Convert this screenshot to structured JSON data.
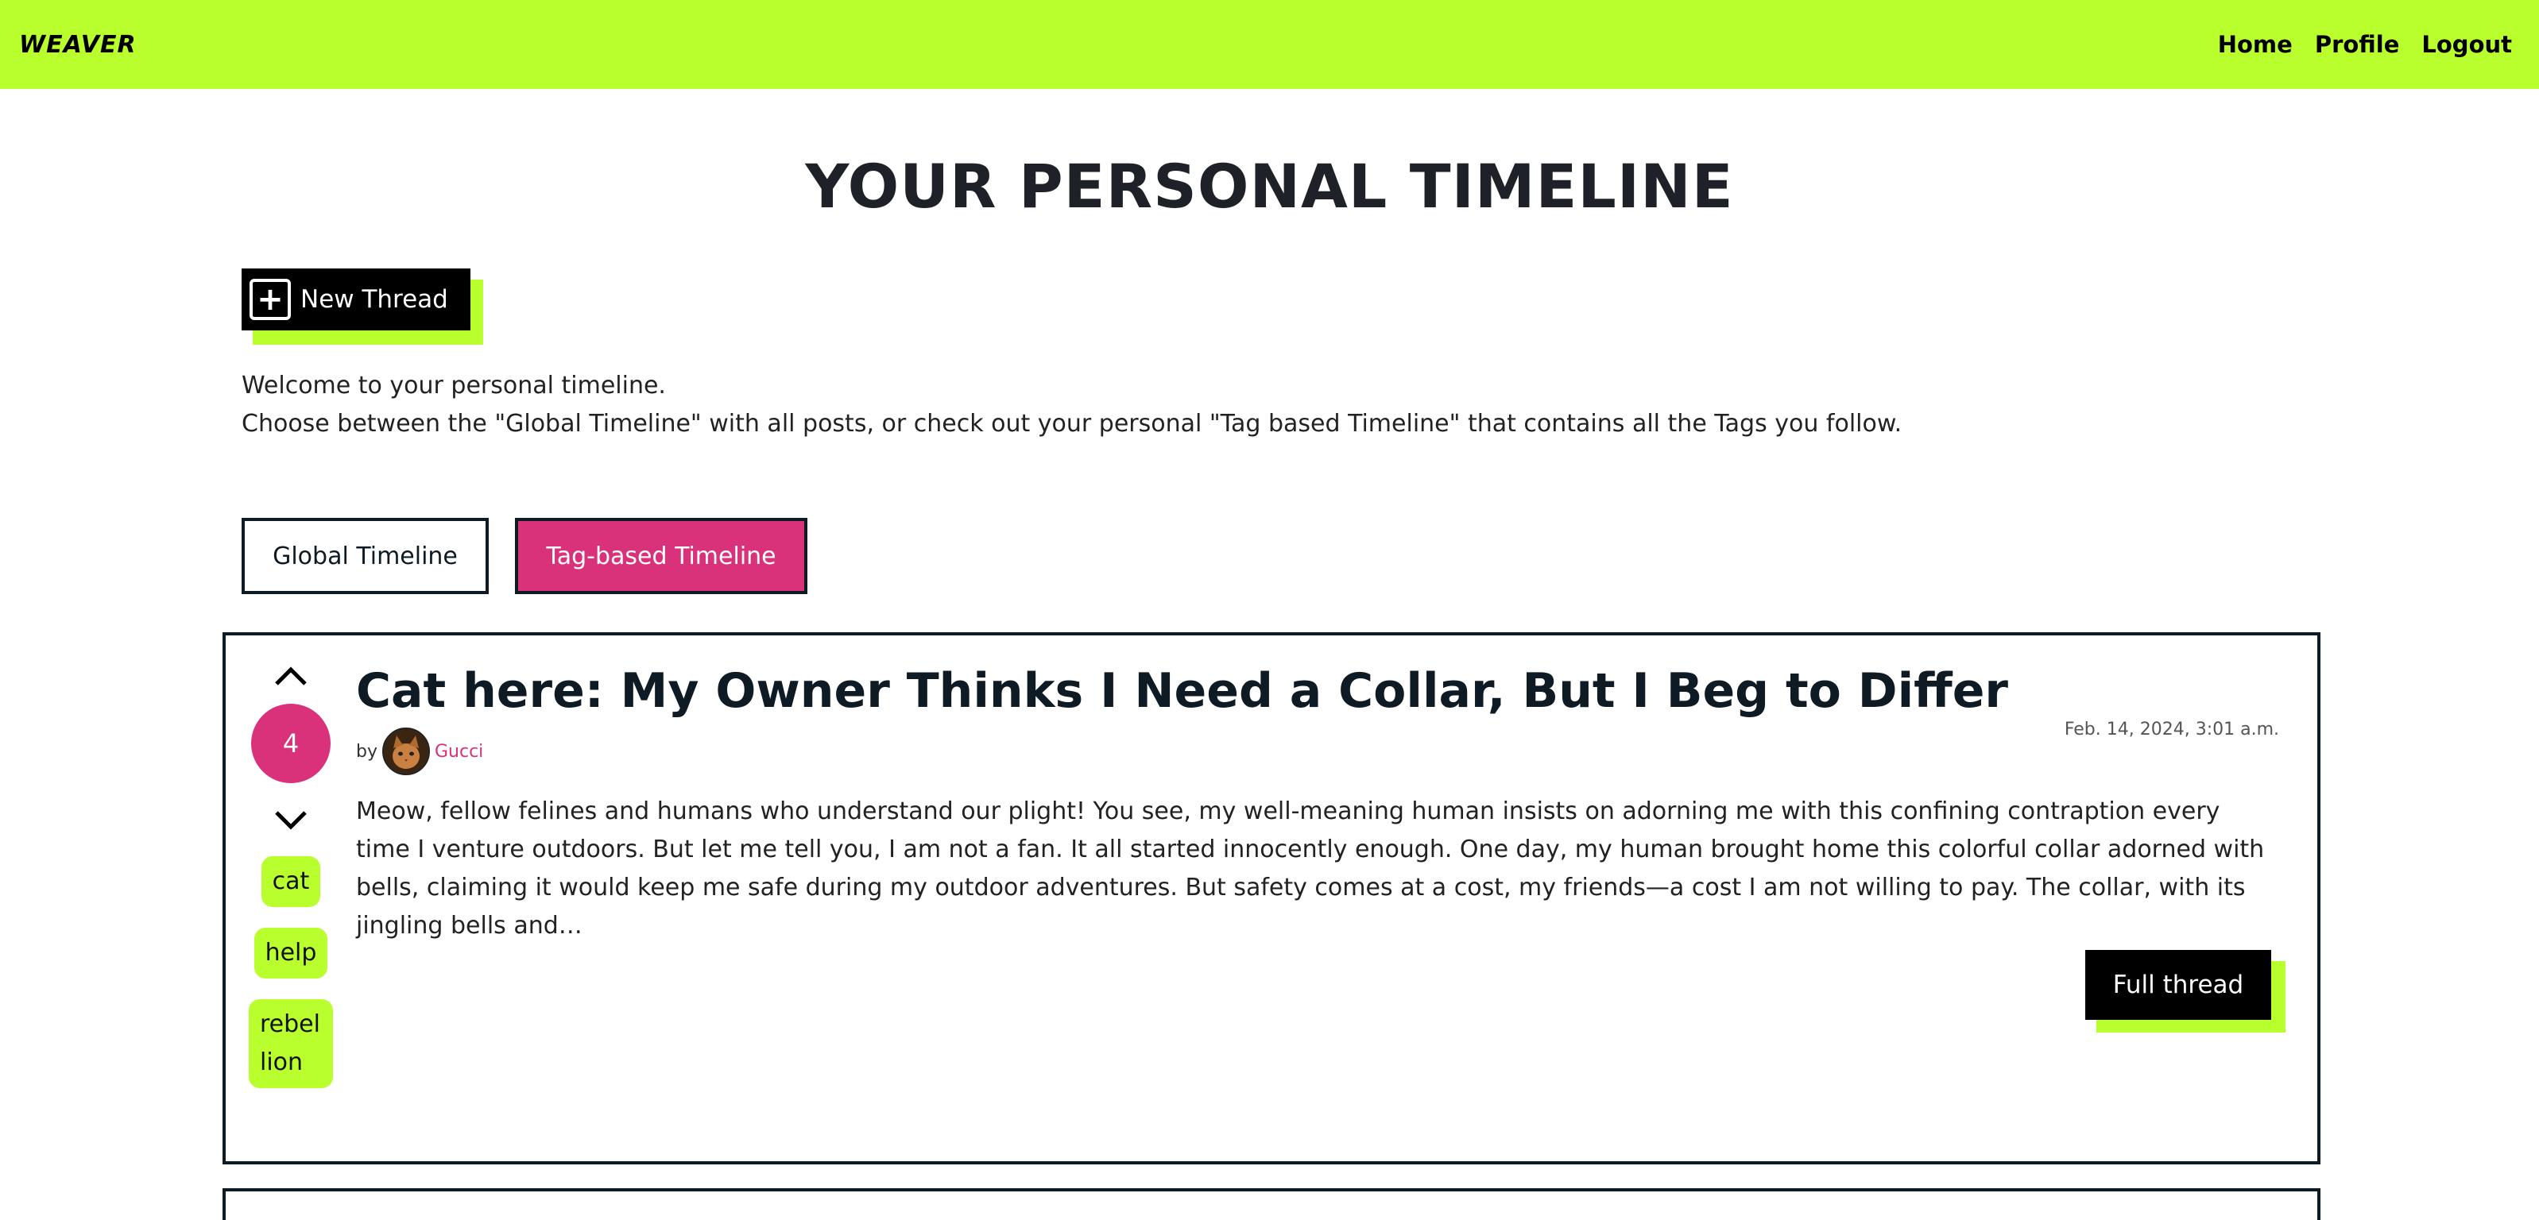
{
  "nav": {
    "logo": "WEAVER",
    "links": [
      "Home",
      "Profile",
      "Logout"
    ]
  },
  "page": {
    "title": "YOUR PERSONAL TIMELINE",
    "new_thread_label": "New Thread",
    "intro_line1": "Welcome to your personal timeline.",
    "intro_line2": "Choose between the \"Global Timeline\" with all posts, or check out your personal \"Tag based Timeline\" that contains all the Tags you follow."
  },
  "timeline_tabs": {
    "global": "Global Timeline",
    "tag_based": "Tag-based Timeline",
    "active": "tag_based"
  },
  "thread": {
    "votes": "4",
    "title": "Cat here: My Owner Thinks I Need a Collar, But I Beg to Differ",
    "by_label": "by",
    "author": "Gucci",
    "date": "Feb. 14, 2024, 3:01 a.m.",
    "excerpt": "Meow, fellow felines and humans who understand our plight! You see, my well-meaning human insists on adorning me with this confining contraption every time I venture outdoors. But let me tell you, I am not a fan. It all started innocently enough. One day, my human brought home this colorful collar adorned with bells, claiming it would keep me safe during my outdoor adventures. But safety comes at a cost, my friends—a cost I am not willing to pay. The collar, with its jingling bells and…",
    "tags": [
      "cat",
      "help",
      "rebel lion"
    ],
    "full_thread_label": "Full thread"
  },
  "colors": {
    "accent_lime": "#b9ff2d",
    "accent_pink": "#d9317a",
    "dark": "#0e1a24"
  }
}
